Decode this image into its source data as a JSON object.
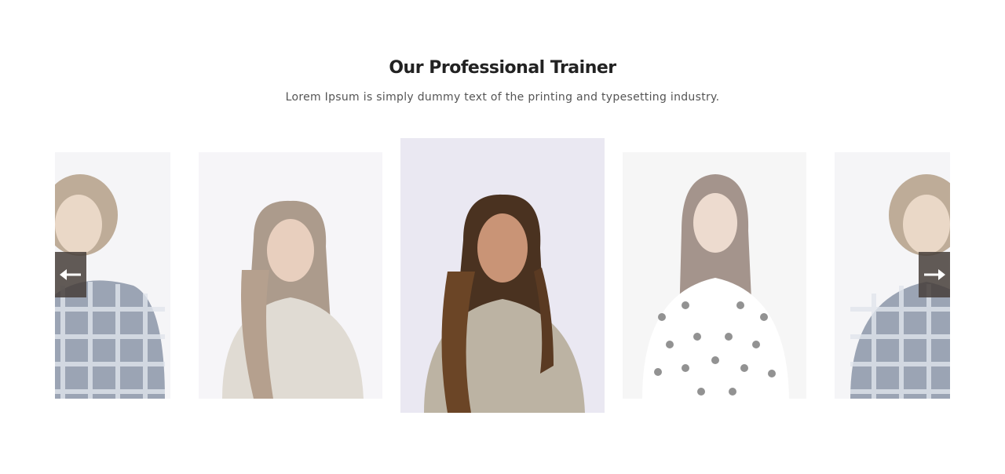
{
  "section": {
    "title": "Our Professional Trainer",
    "subtitle": "Lorem Ipsum is simply dummy text of the printing and typesetting industry."
  },
  "carousel": {
    "active_index": 2,
    "slides": [
      {
        "person": "man-plaid-shirt",
        "active": false
      },
      {
        "person": "woman-sweater",
        "active": false
      },
      {
        "person": "woman-sweater",
        "active": true
      },
      {
        "person": "woman-polka-dot-shirt",
        "active": false
      },
      {
        "person": "man-plaid-shirt",
        "active": false
      }
    ],
    "prev_icon": "arrow-left-icon",
    "next_icon": "arrow-right-icon"
  },
  "colors": {
    "title": "#222222",
    "subtitle": "#555555",
    "nav_bg": "#463e3a",
    "photo_bg": "#eeeef4"
  }
}
